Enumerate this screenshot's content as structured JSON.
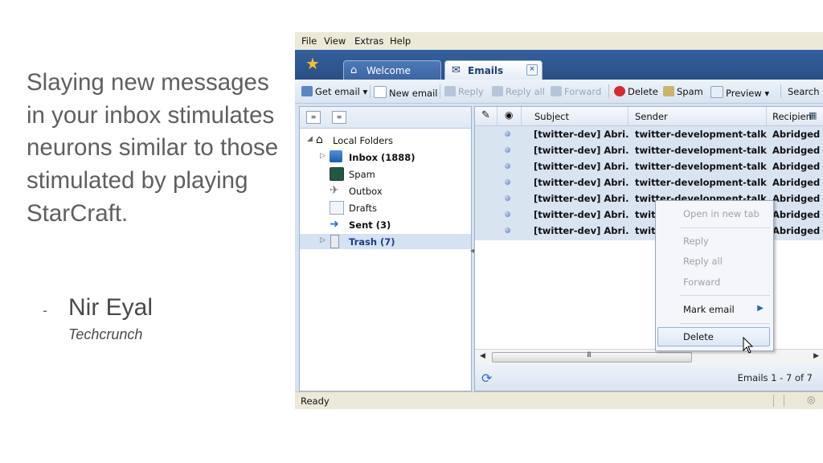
{
  "slide": {
    "quote": "Slaying new messages in your inbox stimulates neurons similar to those stimulated by playing StarCraft.",
    "dash": "-",
    "author": "Nir Eyal",
    "source": "Techcrunch"
  },
  "menu": [
    "File",
    "View",
    "Extras",
    "Help"
  ],
  "tabs": [
    {
      "label": "Welcome",
      "icon": "house-icon",
      "active": false
    },
    {
      "label": "Emails",
      "icon": "mail-icon",
      "active": true,
      "close": "×"
    }
  ],
  "toolbar": {
    "get_email": "Get email",
    "new_email": "New email",
    "reply": "Reply",
    "reply_all": "Reply all",
    "forward": "Forward",
    "delete": "Delete",
    "spam": "Spam",
    "preview": "Preview",
    "search": "Search"
  },
  "folders": {
    "root": "Local Folders",
    "inbox": "Inbox (1888)",
    "spam": "Spam",
    "outbox": "Outbox",
    "drafts": "Drafts",
    "sent": "Sent (3)",
    "trash": "Trash (7)"
  },
  "columns": {
    "subject": "Subject",
    "sender": "Sender",
    "recipient": "Recipien"
  },
  "messages": [
    {
      "subject": "[twitter-dev] Abri...",
      "sender": "twitter-development-talk...",
      "recipient": "Abridged"
    },
    {
      "subject": "[twitter-dev] Abri...",
      "sender": "twitter-development-talk...",
      "recipient": "Abridged"
    },
    {
      "subject": "[twitter-dev] Abri...",
      "sender": "twitter-development-talk...",
      "recipient": "Abridged"
    },
    {
      "subject": "[twitter-dev] Abri...",
      "sender": "twitter-development-talk...",
      "recipient": "Abridged"
    },
    {
      "subject": "[twitter-dev] Abri...",
      "sender": "twitter-development-talk...",
      "recipient": "Abridged"
    },
    {
      "subject": "[twitter-dev] Abri...",
      "sender": "twitt",
      "recipient": "Abridged"
    },
    {
      "subject": "[twitter-dev] Abri...",
      "sender": "twitt",
      "recipient": "Abridged"
    }
  ],
  "scroll_grip": "III",
  "list_status": "Emails 1 - 7 of 7",
  "context_menu": {
    "open_new_tab": "Open in new tab",
    "reply": "Reply",
    "reply_all": "Reply all",
    "forward": "Forward",
    "mark_email": "Mark email",
    "delete": "Delete"
  },
  "status": "Ready",
  "colors": {
    "tab_bar": "#2a4f86",
    "selection": "#d9e4f1",
    "accent": "#2a62b8"
  }
}
